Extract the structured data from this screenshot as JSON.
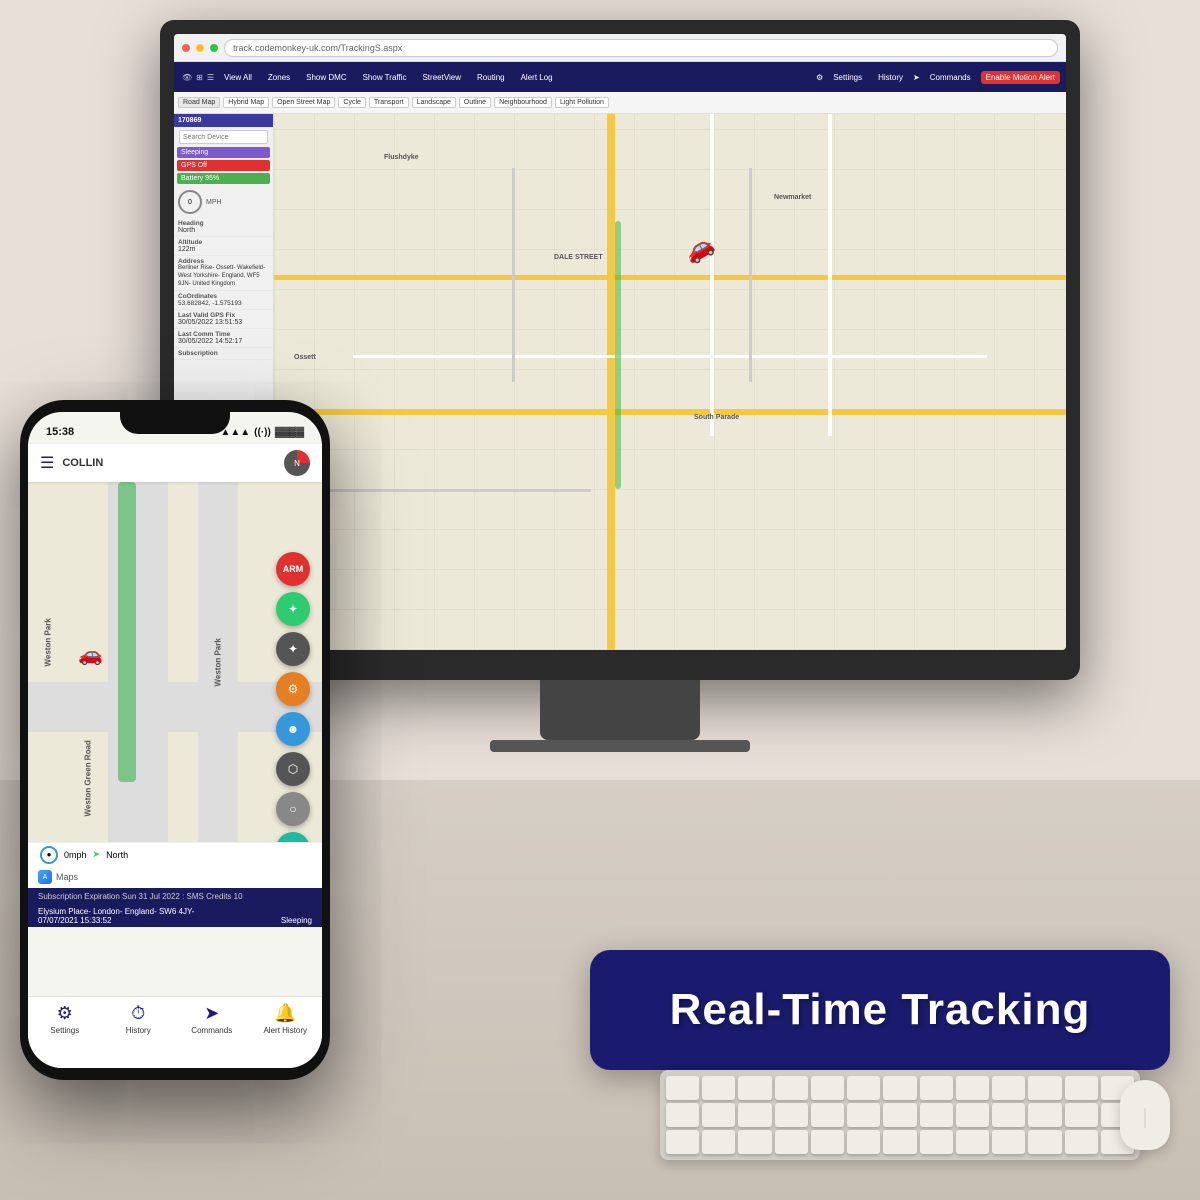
{
  "scene": {
    "background_color": "#e8e0d8"
  },
  "browser": {
    "url": "track.codemonkey-uk.com/TrackingS.aspx",
    "dot_colors": [
      "#ff5f57",
      "#febc2e",
      "#28c840"
    ]
  },
  "app_nav": {
    "items": [
      "View All",
      "Zones",
      "Show DMC",
      "Show Traffic",
      "StreetView",
      "Routing",
      "Alert Log"
    ],
    "right_items": [
      "Settings",
      "History",
      "Commands"
    ],
    "alert_btn": "Enable Motion Alert"
  },
  "map_toolbar": {
    "buttons": [
      "Road Map",
      "Hybrid Map",
      "Open Street Map",
      "Cycle",
      "Transport",
      "Landscape",
      "Outline",
      "Neighbourhood",
      "Light Pollution"
    ]
  },
  "sidebar": {
    "device_id": "170869",
    "search_placeholder": "Search Device",
    "status_sleeping": "Sleeping",
    "status_gps": "GPS Off",
    "status_battery": "Battery  95%",
    "speed_value": "0",
    "speed_unit": "MPH",
    "heading_label": "Heading",
    "heading_value": "North",
    "altitude_label": "Altitude",
    "altitude_value": "122m",
    "address_label": "Address",
    "address_value": "Berliner Rise- Ossett- Wakefield- West Yorkshire- England, WF5 9JN- United Kingdom",
    "coordinates_label": "CoOrdinates",
    "coordinates_value": "53.682842, -1.575193",
    "gps_fix_label": "Last Valid GPS Fix",
    "gps_fix_value": "30/05/2022 13:51:53",
    "comm_label": "Last Comm Time",
    "comm_value": "30/05/2022 14:52:17",
    "subscription_label": "Subscription"
  },
  "phone": {
    "time": "15:38",
    "status_signal": "●●●",
    "status_wifi": "WiFi",
    "status_battery": "████",
    "header_title": "COLLIN",
    "map_labels": [
      "Weston Park",
      "Weston Park",
      "Weston Green Road"
    ],
    "speed_value": "0mph",
    "heading_value": "North",
    "maps_label": "Maps",
    "subscription_bar": "Subscription Expiration Sun 31 Jul 2022 : SMS Credits 10",
    "address_line": "Elysium Place- London- England- SW6 4JY-",
    "datetime_line": "07/07/2021 15:33:52",
    "status_text": "Sleeping",
    "action_buttons": [
      "ARM",
      "⊕",
      "✦",
      "⚙",
      "☻",
      "⬡",
      "○",
      "⊞",
      "✕"
    ],
    "footer_items": [
      {
        "icon": "⚙",
        "label": "Settings"
      },
      {
        "icon": "⏱",
        "label": "History"
      },
      {
        "icon": "➤",
        "label": "Commands"
      },
      {
        "icon": "🔔",
        "label": "Alert History"
      }
    ]
  },
  "banner": {
    "text": "Real-Time Tracking"
  },
  "keyboard": {
    "visible": true
  },
  "mouse": {
    "visible": true
  }
}
